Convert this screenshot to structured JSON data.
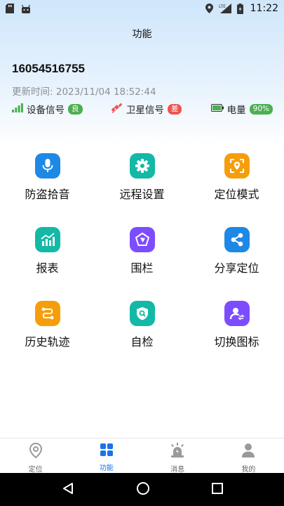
{
  "status_bar": {
    "time": "11:22",
    "network": "LTE"
  },
  "page": {
    "title": "功能"
  },
  "device": {
    "id": "16054516755",
    "update_label": "更新时间:",
    "update_time": "2023/11/04 18:52:44"
  },
  "signals": [
    {
      "label": "设备信号",
      "badge": "良",
      "badge_color": "#4caf50",
      "icon": "signal-bars-icon"
    },
    {
      "label": "卫星信号",
      "badge": "差",
      "badge_color": "#ef5350",
      "icon": "satellite-icon"
    },
    {
      "label": "电量",
      "badge": "90%",
      "badge_color": "#4caf50",
      "icon": "battery-icon"
    }
  ],
  "features": [
    {
      "label": "防盗拾音",
      "icon": "microphone-icon",
      "color": "#1e88e5"
    },
    {
      "label": "远程设置",
      "icon": "gear-icon",
      "color": "#14b8a6"
    },
    {
      "label": "定位模式",
      "icon": "locate-frame-icon",
      "color": "#f59e0b"
    },
    {
      "label": "报表",
      "icon": "chart-icon",
      "color": "#14b8a6"
    },
    {
      "label": "围栏",
      "icon": "fence-polygon-icon",
      "color": "#7c4dff"
    },
    {
      "label": "分享定位",
      "icon": "share-icon",
      "color": "#1e88e5"
    },
    {
      "label": "历史轨迹",
      "icon": "route-icon",
      "color": "#f59e0b"
    },
    {
      "label": "自检",
      "icon": "shield-search-icon",
      "color": "#14b8a6"
    },
    {
      "label": "切换图标",
      "icon": "user-switch-icon",
      "color": "#7c4dff"
    }
  ],
  "bottom_nav": [
    {
      "label": "定位",
      "icon": "location-pin-icon"
    },
    {
      "label": "功能",
      "icon": "grid-icon",
      "active": true
    },
    {
      "label": "消息",
      "icon": "alarm-icon"
    },
    {
      "label": "我的",
      "icon": "person-icon"
    }
  ],
  "colors": {
    "accent": "#1a73e8",
    "inactive_icon": "#9a9a9a"
  }
}
